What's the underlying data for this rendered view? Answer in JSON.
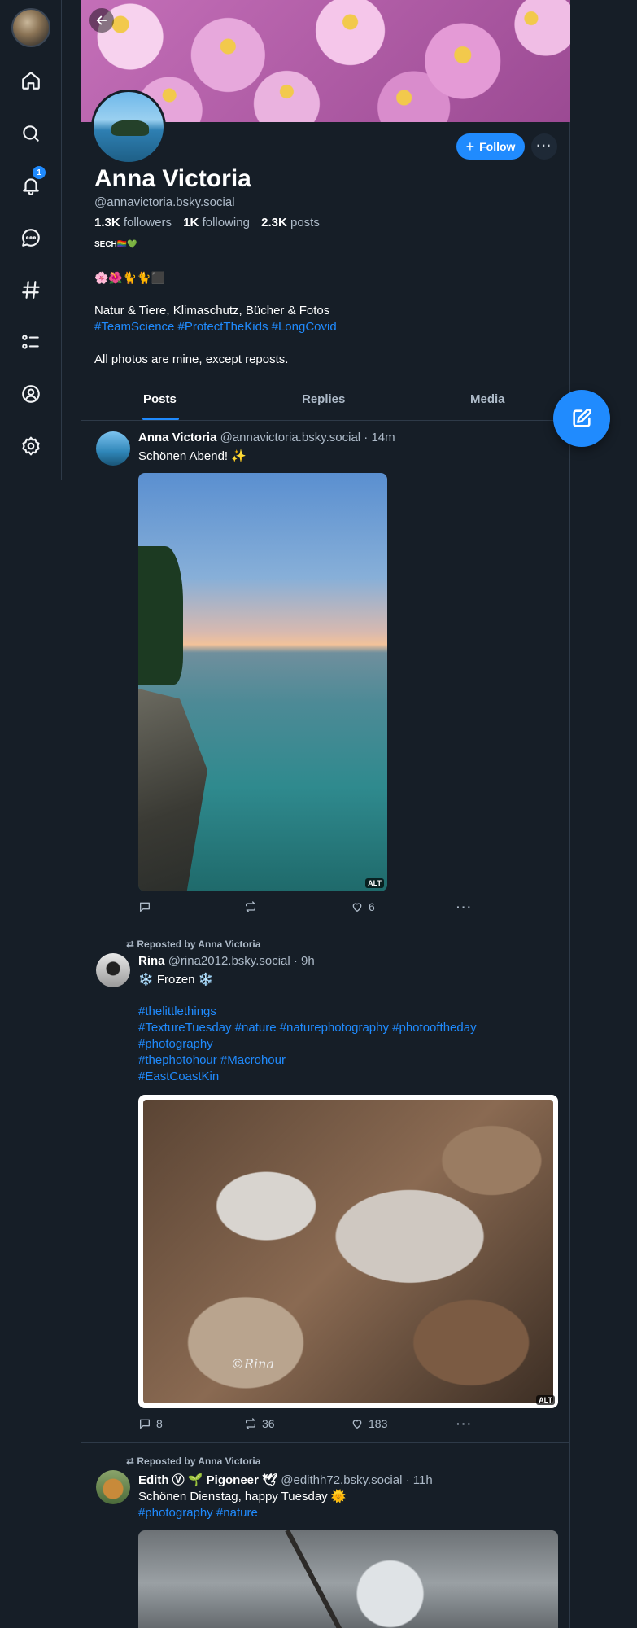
{
  "nav": {
    "notifications_count": "1",
    "items": [
      "home",
      "search",
      "notifications",
      "chat",
      "feeds",
      "lists",
      "profile",
      "settings"
    ]
  },
  "profile": {
    "name": "Anna Victoria",
    "handle": "@annavictoria.bsky.social",
    "followers_count": "1.3K",
    "followers_label": "followers",
    "following_count": "1K",
    "following_label": "following",
    "posts_count": "2.3K",
    "posts_label": "posts",
    "follow_label": "Follow",
    "more_label": "···",
    "bio_tag": "SECH🏳️‍🌈💚",
    "bio_emoji": "🌸🌺🐈🐈⬛",
    "bio_line1": "Natur & Tiere, Klimaschutz, Bücher & Fotos",
    "bio_hashtags": "#TeamScience #ProtectTheKids #LongCovid",
    "bio_line3": "All photos are mine, except reposts."
  },
  "tabs": [
    "Posts",
    "Replies",
    "Media"
  ],
  "colors": {
    "accent": "#208bfe",
    "background": "#161e27",
    "border": "#2e3a48",
    "muted": "#aebbc9"
  },
  "posts": [
    {
      "author_name": "Anna Victoria",
      "author_handle": "@annavictoria.bsky.social",
      "time": "· 14m",
      "text": "Schönen Abend! ✨",
      "alt": "ALT",
      "reply_count": "",
      "repost_count": "",
      "like_count": "6"
    },
    {
      "repost_label": "Reposted by Anna Victoria",
      "author_name": "Rina",
      "author_handle": "@rina2012.bsky.social",
      "time": "· 9h",
      "text": "❄️ Frozen ❄️",
      "tags": [
        "#thelittlethings",
        "#TextureTuesday #nature #naturephotography #photooftheday",
        "#photography",
        "#thephotohour #Macrohour",
        "#EastCoastKin"
      ],
      "image_signature": "©Rina",
      "alt": "ALT",
      "reply_count": "8",
      "repost_count": "36",
      "like_count": "183"
    },
    {
      "repost_label": "Reposted by Anna Victoria",
      "author_name": "Edith Ⓥ 🌱 Pigoneer 🕊",
      "author_handle": "@edithh72.bsky.social",
      "time": "· 11h",
      "text": "Schönen Dienstag, happy Tuesday 🌞",
      "tags": "#photography #nature"
    }
  ]
}
